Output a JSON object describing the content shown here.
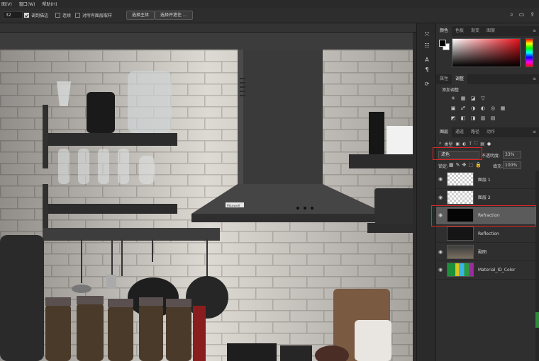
{
  "menubar": {
    "items": [
      "图(V)",
      "窗口(W)",
      "帮助(H)"
    ]
  },
  "options": {
    "size_value": "32",
    "sample_all_layers_label": "调到描边",
    "contiguous_label": "连续",
    "all_layers_label": "对所有图层取样",
    "select_subject_label": "选择主体",
    "select_and_mask_label": "选择并遮住 ...",
    "right_icons": [
      "search-icon",
      "window-arrange-icon",
      "share-icon"
    ]
  },
  "tools": [
    "arrange-icon",
    "adjust-icon",
    "text-ai-icon",
    "paragraph-icon",
    "transform-icon"
  ],
  "color_panel": {
    "tabs": [
      "颜色",
      "色板",
      "渐变",
      "图案"
    ],
    "active_tab": 0,
    "fg": "#000000",
    "bg": "#ffffff",
    "hue_color": "#e8111a"
  },
  "adjust_panel": {
    "tabs": [
      "属性",
      "调整"
    ],
    "active_tab": 1,
    "title": "添加调整",
    "row1": [
      "☀",
      "▦",
      "◪",
      "▽"
    ],
    "row2": [
      "▣",
      "☍",
      "◑",
      "◐",
      "◎",
      "▦"
    ],
    "row3": [
      "◩",
      "◧",
      "◨",
      "▥",
      "▤"
    ]
  },
  "layers_panel": {
    "tabs": [
      "图层",
      "通道",
      "路径",
      "动作"
    ],
    "active_tab": 0,
    "filter_label": "类型",
    "blend_mode": "滤色",
    "opacity_label": "不透明度:",
    "opacity_value": "33%",
    "lock_label": "锁定:",
    "fill_label": "填充:",
    "fill_value": "100%",
    "layers": [
      {
        "name": "图层 1",
        "visible": true,
        "thumb": "trans",
        "selected": false
      },
      {
        "name": "图层 2",
        "visible": true,
        "thumb": "trans",
        "selected": false
      },
      {
        "name": "Refraction",
        "visible": true,
        "thumb": "black",
        "selected": true
      },
      {
        "name": "Reflection",
        "visible": false,
        "thumb": "dark",
        "selected": false
      },
      {
        "name": "副图",
        "visible": true,
        "thumb": "photo",
        "selected": false
      },
      {
        "name": "Material_ID_Color",
        "visible": true,
        "thumb": "mat",
        "selected": false
      }
    ]
  },
  "image": {
    "hood_brand": "Maxwell"
  },
  "annotation_color": "#e02626"
}
